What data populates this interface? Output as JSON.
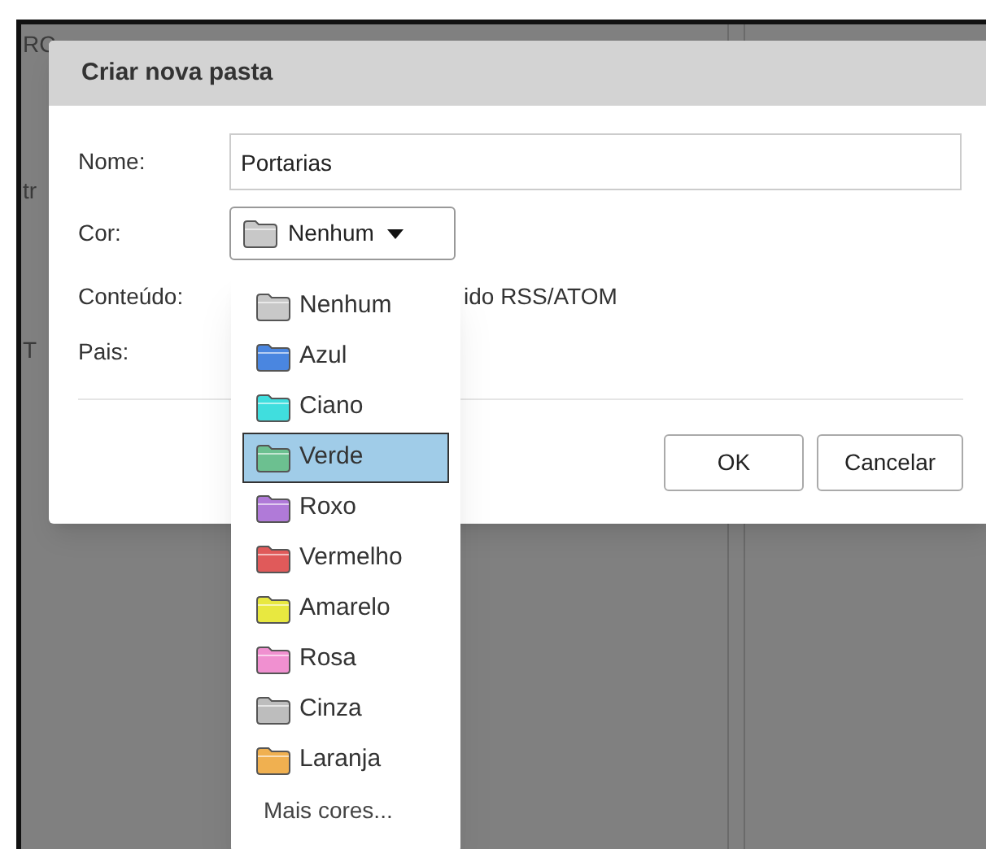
{
  "background": {
    "fragments": [
      "RC",
      "tr",
      "T"
    ]
  },
  "dialog": {
    "title": "Criar nova pasta",
    "fields": [
      {
        "kind": "text",
        "label": "Nome:",
        "value": "Portarias"
      },
      {
        "kind": "color",
        "label": "Cor:",
        "value": "Nenhum",
        "color": "#c8c8c8"
      },
      {
        "kind": "static",
        "label": "Conteúdo:",
        "value": "ido RSS/ATOM"
      },
      {
        "kind": "static",
        "label": "Pais:"
      }
    ],
    "buttons": [
      "OK",
      "Cancelar"
    ]
  },
  "dropdown": {
    "items": [
      {
        "kind": "color",
        "label": "Nenhum",
        "color": "#c8c8c8",
        "selected": false
      },
      {
        "kind": "color",
        "label": "Azul",
        "color": "#4a86e0",
        "selected": false
      },
      {
        "kind": "color",
        "label": "Ciano",
        "color": "#40dede",
        "selected": false
      },
      {
        "kind": "color",
        "label": "Verde",
        "color": "#6cc090",
        "selected": true
      },
      {
        "kind": "color",
        "label": "Roxo",
        "color": "#b07ad8",
        "selected": false
      },
      {
        "kind": "color",
        "label": "Vermelho",
        "color": "#e05a5a",
        "selected": false
      },
      {
        "kind": "color",
        "label": "Amarelo",
        "color": "#e8e840",
        "selected": false
      },
      {
        "kind": "color",
        "label": "Rosa",
        "color": "#f090d0",
        "selected": false
      },
      {
        "kind": "color",
        "label": "Cinza",
        "color": "#bdbdbd",
        "selected": false
      },
      {
        "kind": "color",
        "label": "Laranja",
        "color": "#f0b050",
        "selected": false
      },
      {
        "kind": "more",
        "label": "Mais cores...",
        "selected": false
      }
    ]
  }
}
